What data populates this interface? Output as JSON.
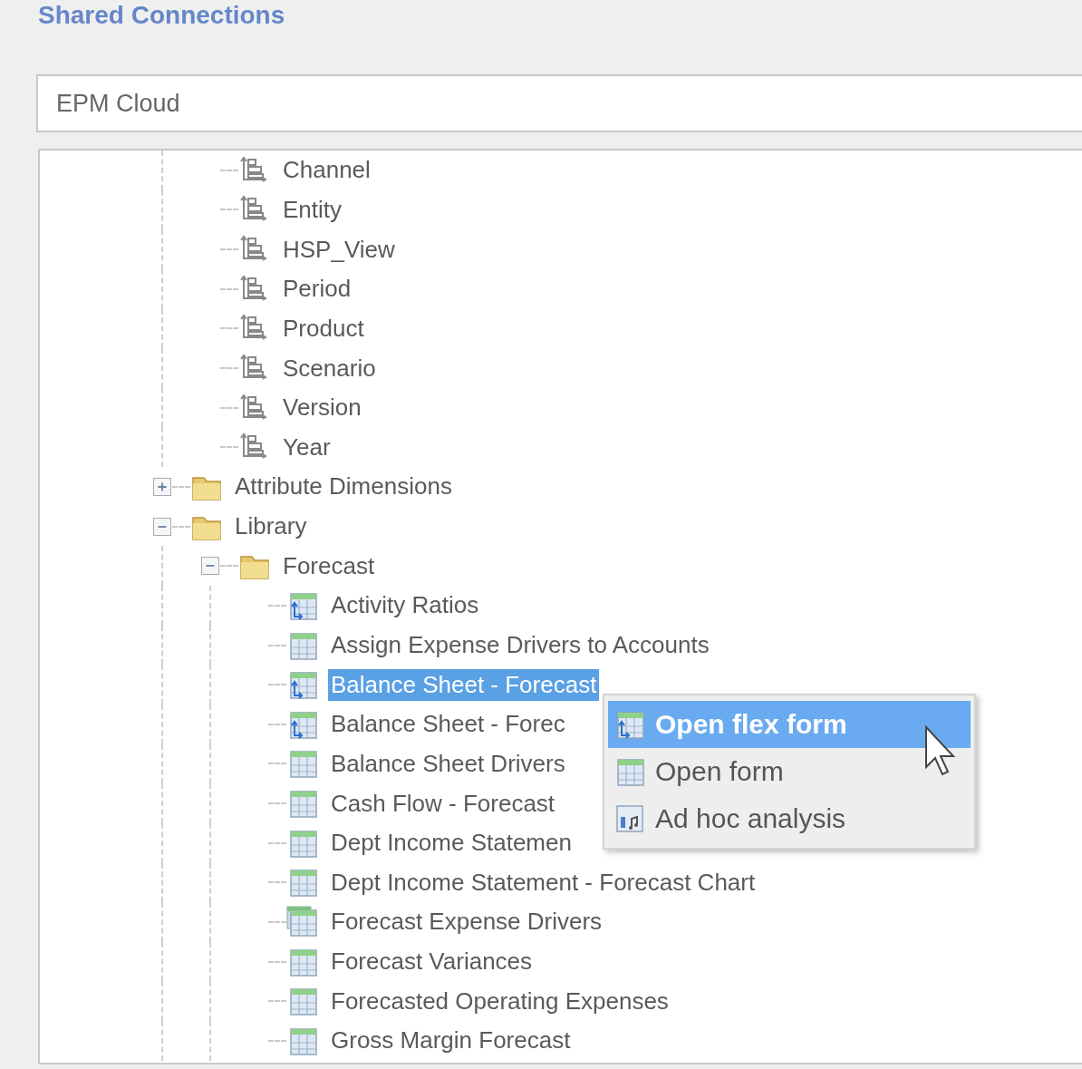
{
  "section_title": "Shared Connections",
  "connection_field": {
    "value": "EPM Cloud"
  },
  "tree": {
    "items": [
      {
        "children": [
          {
            "label": "Channel",
            "kind": "dimension"
          },
          {
            "label": "Entity",
            "kind": "dimension"
          },
          {
            "label": "HSP_View",
            "kind": "dimension"
          },
          {
            "label": "Period",
            "kind": "dimension"
          },
          {
            "label": "Product",
            "kind": "dimension"
          },
          {
            "label": "Scenario",
            "kind": "dimension"
          },
          {
            "label": "Version",
            "kind": "dimension"
          },
          {
            "label": "Year",
            "kind": "dimension"
          }
        ]
      },
      {
        "label": "Attribute Dimensions",
        "kind": "folder",
        "expanded": false
      },
      {
        "label": "Library",
        "kind": "folder",
        "expanded": true,
        "children": [
          {
            "label": "Forecast",
            "kind": "folder",
            "expanded": true,
            "children": [
              {
                "label": "Activity Ratios",
                "kind": "flex-form",
                "selected": false
              },
              {
                "label": "Assign Expense Drivers to Accounts",
                "kind": "form",
                "selected": false
              },
              {
                "label": "Balance Sheet - Forecast",
                "kind": "flex-form",
                "selected": true
              },
              {
                "label": "Balance Sheet - Forec",
                "kind": "flex-form",
                "selected": false
              },
              {
                "label": "Balance Sheet Drivers",
                "kind": "form",
                "selected": false
              },
              {
                "label": "Cash Flow - Forecast",
                "kind": "form",
                "selected": false
              },
              {
                "label": "Dept Income Statemen",
                "kind": "form",
                "selected": false
              },
              {
                "label": "Dept Income Statement - Forecast Chart",
                "kind": "form",
                "selected": false
              },
              {
                "label": "Forecast Expense Drivers",
                "kind": "composite-form",
                "selected": false
              },
              {
                "label": "Forecast Variances",
                "kind": "form",
                "selected": false
              },
              {
                "label": "Forecasted Operating Expenses",
                "kind": "form",
                "selected": false
              },
              {
                "label": "Gross Margin Forecast",
                "kind": "form",
                "selected": false
              }
            ]
          }
        ]
      }
    ]
  },
  "context_menu": {
    "items": [
      {
        "label": "Open flex form",
        "kind": "flex-form",
        "selected": true
      },
      {
        "label": "Open form",
        "kind": "form",
        "selected": false
      },
      {
        "label": "Ad hoc analysis",
        "kind": "adhoc",
        "selected": false
      }
    ]
  }
}
